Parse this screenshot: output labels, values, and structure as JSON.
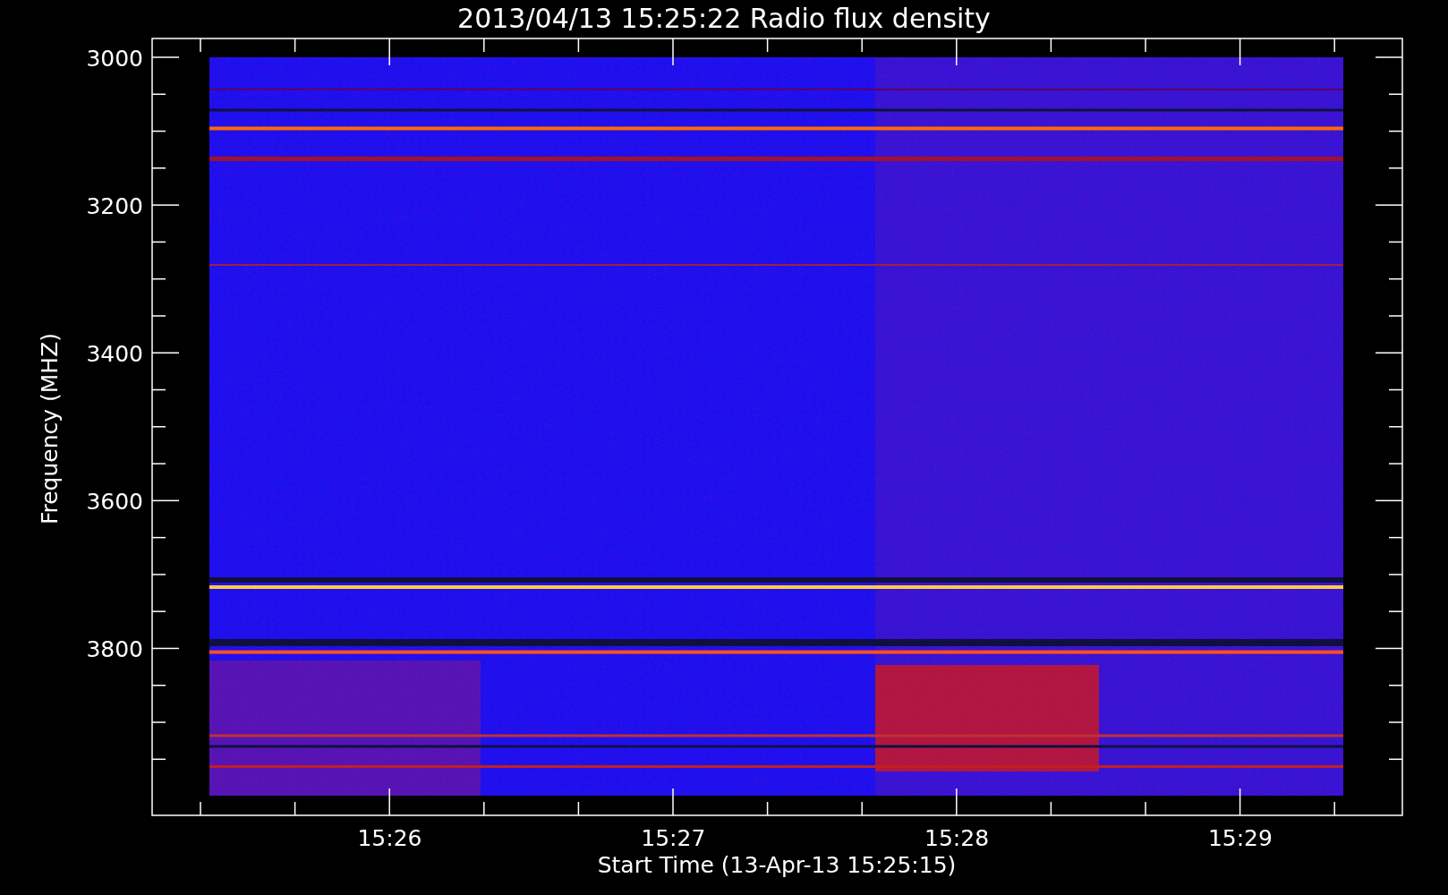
{
  "title": "2013/04/13 15:25:22 Radio flux density",
  "y_axis": {
    "label": "Frequency (MHZ)",
    "ticks": [
      "3000",
      "3200",
      "3400",
      "3600",
      "3800"
    ]
  },
  "x_axis": {
    "label": "Start Time (13-Apr-13 15:25:15)",
    "ticks": [
      "15:26",
      "15:27",
      "15:28",
      "15:29"
    ]
  }
}
